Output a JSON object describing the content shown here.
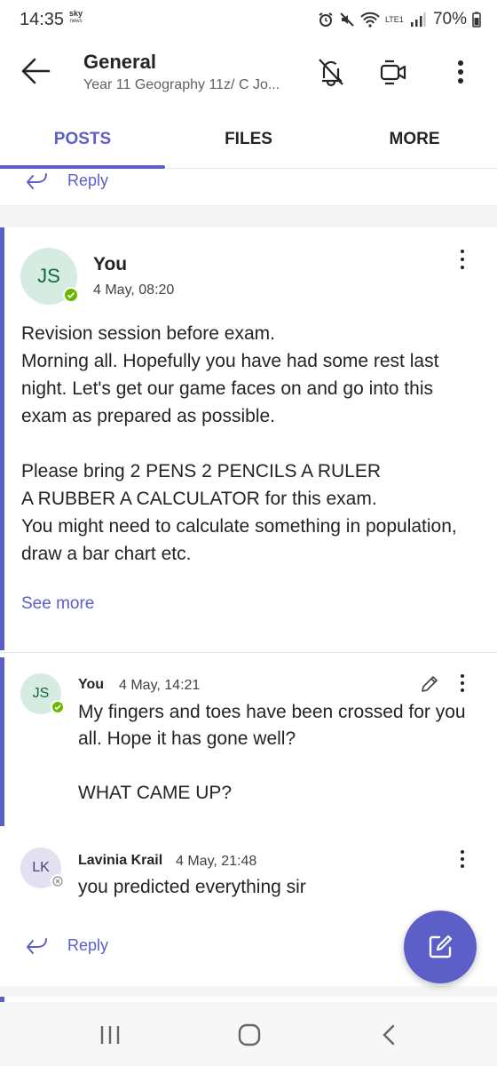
{
  "status_bar": {
    "time": "14:35",
    "news_logo_text": "sky",
    "news_logo_sub": "news",
    "battery": "70%",
    "network": "LTE1"
  },
  "header": {
    "title": "General",
    "subtitle": "Year 11 Geography 11z/ C Jo..."
  },
  "tabs": [
    {
      "label": "POSTS",
      "active": true
    },
    {
      "label": "FILES",
      "active": false
    },
    {
      "label": "MORE",
      "active": false
    }
  ],
  "prev_post": {
    "reply_label": "Reply"
  },
  "post": {
    "avatar_initials": "JS",
    "author": "You",
    "timestamp": "4 May, 08:20",
    "body": {
      "line1": "Revision session before exam.",
      "para1": "Morning all. Hopefully you have had some rest last night. Let's get our game faces on and go into this exam as prepared as possible.",
      "para2_line1": "Please bring 2 PENS 2 PENCILS A RULER",
      "para2_line2": "A RUBBER A CALCULATOR for this exam.",
      "para2_rest": "You might need to calculate something in population, draw a bar chart etc."
    },
    "see_more": "See more",
    "replies": [
      {
        "avatar_initials": "JS",
        "author": "You",
        "timestamp": "4 May, 14:21",
        "text1": "My fingers and toes have been crossed for you all. Hope it has gone well?",
        "text2": "WHAT CAME UP?"
      },
      {
        "avatar_initials": "LK",
        "author": "Lavinia Krail",
        "timestamp": "4 May, 21:48",
        "text1": "you predicted everything sir"
      }
    ],
    "reply_label": "Reply"
  },
  "colors": {
    "accent": "#5b5fc7",
    "presence_available": "#6bb700"
  }
}
